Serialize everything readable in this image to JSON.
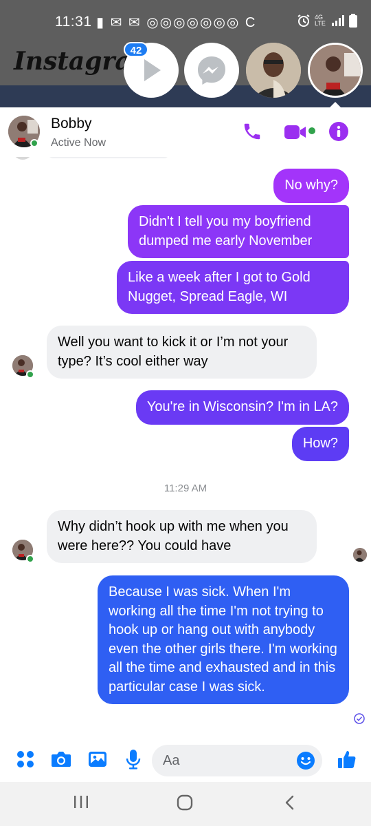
{
  "status_bar": {
    "time": "11:31",
    "notification_icons": "▮ ✉ ✉ ◎◎◎◎◎◎◎ C",
    "network": "4G LTE"
  },
  "instagram": {
    "logo": "Instagram",
    "badge_count": "42"
  },
  "chat": {
    "contact_name": "Bobby",
    "contact_status": "Active Now"
  },
  "messages": [
    {
      "id": "m1",
      "direction": "outgoing",
      "text": "No why?"
    },
    {
      "id": "m2",
      "direction": "outgoing",
      "text": "Didn't I tell you my boyfriend dumped me early November"
    },
    {
      "id": "m3",
      "direction": "outgoing",
      "text": "Like a week after I got to Gold Nugget, Spread Eagle, WI"
    },
    {
      "id": "m4",
      "direction": "incoming",
      "text": "Well you want to kick it or I’m not your type?  It’s cool either way"
    },
    {
      "id": "m5",
      "direction": "outgoing",
      "text": "You're in Wisconsin?  I'm in LA?"
    },
    {
      "id": "m6",
      "direction": "outgoing",
      "text": "How?"
    },
    {
      "id": "m7",
      "direction": "incoming",
      "text": "Why didn’t hook up with me when you were here?? You could have"
    },
    {
      "id": "m8",
      "direction": "outgoing",
      "text": "Because I was sick.   When I'm working all the time I'm not trying to hook up or hang out with anybody even the other girls there.  I'm working all the time and exhausted and in this particular case I was sick."
    }
  ],
  "timestamp": "11:29 AM",
  "composer": {
    "placeholder": "Aa"
  },
  "colors": {
    "purple": "#a334fa",
    "violet": "#7b38f5",
    "blue": "#2f5ff3",
    "accent_icon": "#9b2ff0",
    "messenger_blue": "#0a7cff"
  }
}
